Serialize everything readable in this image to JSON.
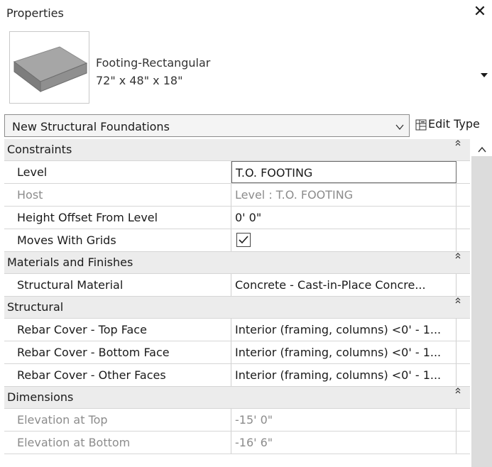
{
  "panel": {
    "title": "Properties",
    "close_glyph": "✕"
  },
  "type_selector": {
    "family": "Footing-Rectangular",
    "type": "72\" x 48\" x 18\""
  },
  "instance_filter": {
    "label": "New Structural Foundations"
  },
  "edit_type": {
    "label": "Edit Type"
  },
  "sections": [
    {
      "label": "Constraints",
      "rows": [
        {
          "name": "Level",
          "value": "T.O. FOOTING",
          "editable": true
        },
        {
          "name": "Host",
          "value": "Level : T.O. FOOTING",
          "disabled": true
        },
        {
          "name": "Height Offset From Level",
          "value": "0'  0\""
        },
        {
          "name": "Moves With Grids",
          "checkbox": true,
          "checked": true
        }
      ]
    },
    {
      "label": "Materials and Finishes",
      "rows": [
        {
          "name": "Structural Material",
          "value": "Concrete - Cast-in-Place Concre..."
        }
      ]
    },
    {
      "label": "Structural",
      "rows": [
        {
          "name": "Rebar Cover - Top Face",
          "value": "Interior (framing, columns) <0' - 1..."
        },
        {
          "name": "Rebar Cover - Bottom Face",
          "value": "Interior (framing, columns) <0' - 1..."
        },
        {
          "name": "Rebar Cover - Other Faces",
          "value": "Interior (framing, columns) <0' - 1..."
        }
      ]
    },
    {
      "label": "Dimensions",
      "rows": [
        {
          "name": "Elevation at Top",
          "value": "-15'  0\"",
          "disabled": true
        },
        {
          "name": "Elevation at Bottom",
          "value": "-16'  6\"",
          "disabled": true
        }
      ]
    }
  ],
  "icons": {
    "close": "close-icon",
    "thumbnail": "footing-thumbnail-icon",
    "type_dropdown": "caret-down-icon",
    "instance_dropdown": "chevron-down-icon",
    "edit_type": "edit-type-icon",
    "collapse": "collapse-chevron-icon",
    "scroll_up": "scroll-up-icon"
  }
}
